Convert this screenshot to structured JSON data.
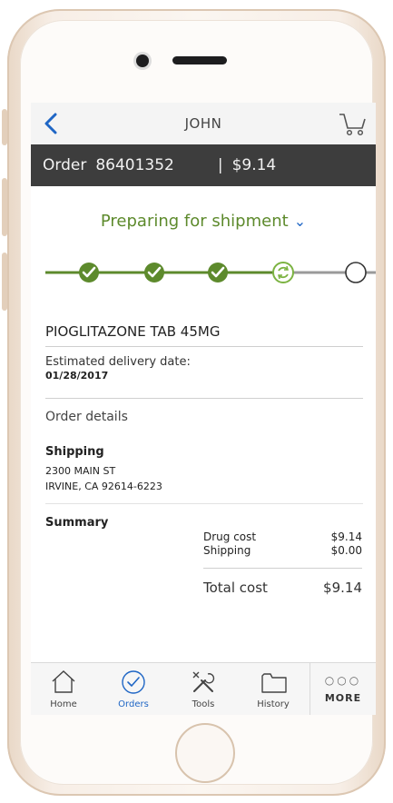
{
  "header": {
    "title": "JOHN"
  },
  "order": {
    "label": "Order",
    "number": "86401352",
    "separator": "|",
    "amount": "$9.14"
  },
  "status": {
    "text": "Preparing for shipment"
  },
  "tracker": {
    "steps_completed": 3,
    "current_step": 4,
    "total_steps": 5
  },
  "item": {
    "name": "PIOGLITAZONE TAB 45MG",
    "est_label": "Estimated delivery date:",
    "est_date": "01/28/2017",
    "details_link": "Order details"
  },
  "shipping": {
    "heading": "Shipping",
    "line1": "2300 MAIN ST",
    "line2": "IRVINE, CA 92614-6223"
  },
  "summary": {
    "heading": "Summary",
    "drug_label": "Drug cost",
    "drug_value": "$9.14",
    "ship_label": "Shipping",
    "ship_value": "$0.00",
    "total_label": "Total cost",
    "total_value": "$9.14"
  },
  "tabs": {
    "home": "Home",
    "orders": "Orders",
    "tools": "Tools",
    "history": "History",
    "more": "MORE",
    "more_dots": "○○○"
  },
  "colors": {
    "accent": "#1f66c5",
    "success": "#5d8a2c",
    "bar": "#3d3d3d"
  }
}
